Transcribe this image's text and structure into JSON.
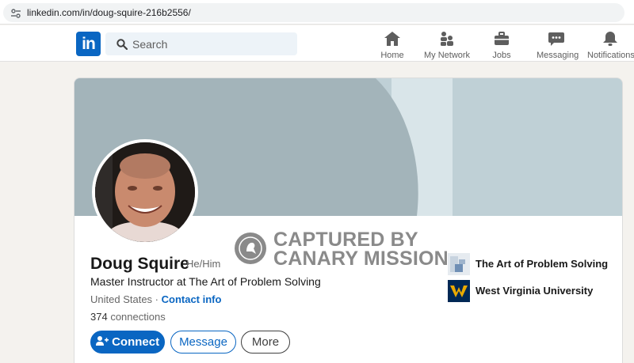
{
  "browser": {
    "url": "linkedin.com/in/doug-squire-216b2556/"
  },
  "nav": {
    "search_placeholder": "Search",
    "items": [
      {
        "label": "Home",
        "icon": "home-icon"
      },
      {
        "label": "My Network",
        "icon": "people-icon"
      },
      {
        "label": "Jobs",
        "icon": "briefcase-icon"
      },
      {
        "label": "Messaging",
        "icon": "chat-icon"
      },
      {
        "label": "Notifications",
        "icon": "bell-icon"
      }
    ],
    "logo_text": "in"
  },
  "watermark": {
    "line1": "CAPTURED BY",
    "line2": "CANARY MISSION"
  },
  "profile": {
    "name": "Doug Squire",
    "pronouns": "He/Him",
    "headline": "Master Instructor at The Art of Problem Solving",
    "location": "United States",
    "separator": " · ",
    "contact_label": "Contact info",
    "connections_count": "374",
    "connections_label": " connections"
  },
  "actions": {
    "connect": "Connect",
    "message": "Message",
    "more": "More"
  },
  "experience": [
    {
      "name": "The Art of Problem Solving"
    },
    {
      "name": "West Virginia University"
    }
  ],
  "colors": {
    "brand": "#0a66c2",
    "banner_dark": "#a3b4ba",
    "banner_light": "#bfd0d6"
  }
}
